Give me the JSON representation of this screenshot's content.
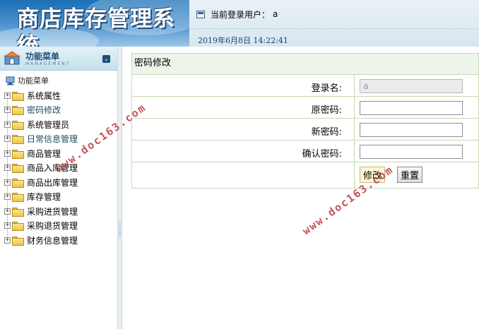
{
  "banner": {
    "title": "商店库存管理系统"
  },
  "topbar": {
    "user_label": "当前登录用户：",
    "user_value": "a",
    "datetime": "2019年6月8日  14:22:41"
  },
  "sidebar": {
    "title": "功能菜单",
    "subtitle": "MANAGEMENT",
    "root_label": "功能菜单",
    "items": [
      {
        "label": "系统属性"
      },
      {
        "label": "密码修改"
      },
      {
        "label": "系统管理员"
      },
      {
        "label": "日常信息管理"
      },
      {
        "label": "商品管理"
      },
      {
        "label": "商品入库管理"
      },
      {
        "label": "商品出库管理"
      },
      {
        "label": "库存管理"
      },
      {
        "label": "采购进货管理"
      },
      {
        "label": "采购退货管理"
      },
      {
        "label": "财务信息管理"
      }
    ]
  },
  "form": {
    "title": "密码修改",
    "login_label": "登录名:",
    "login_value": "a",
    "old_label": "原密码:",
    "new_label": "新密码:",
    "confirm_label": "确认密码:",
    "submit_label": "修改",
    "reset_label": "重置"
  },
  "watermark": {
    "text": "www.doc163.com"
  },
  "colors": {
    "accent": "#1f4d7a",
    "panel_border": "#c8d7b4",
    "watermark": "#b8383c"
  }
}
